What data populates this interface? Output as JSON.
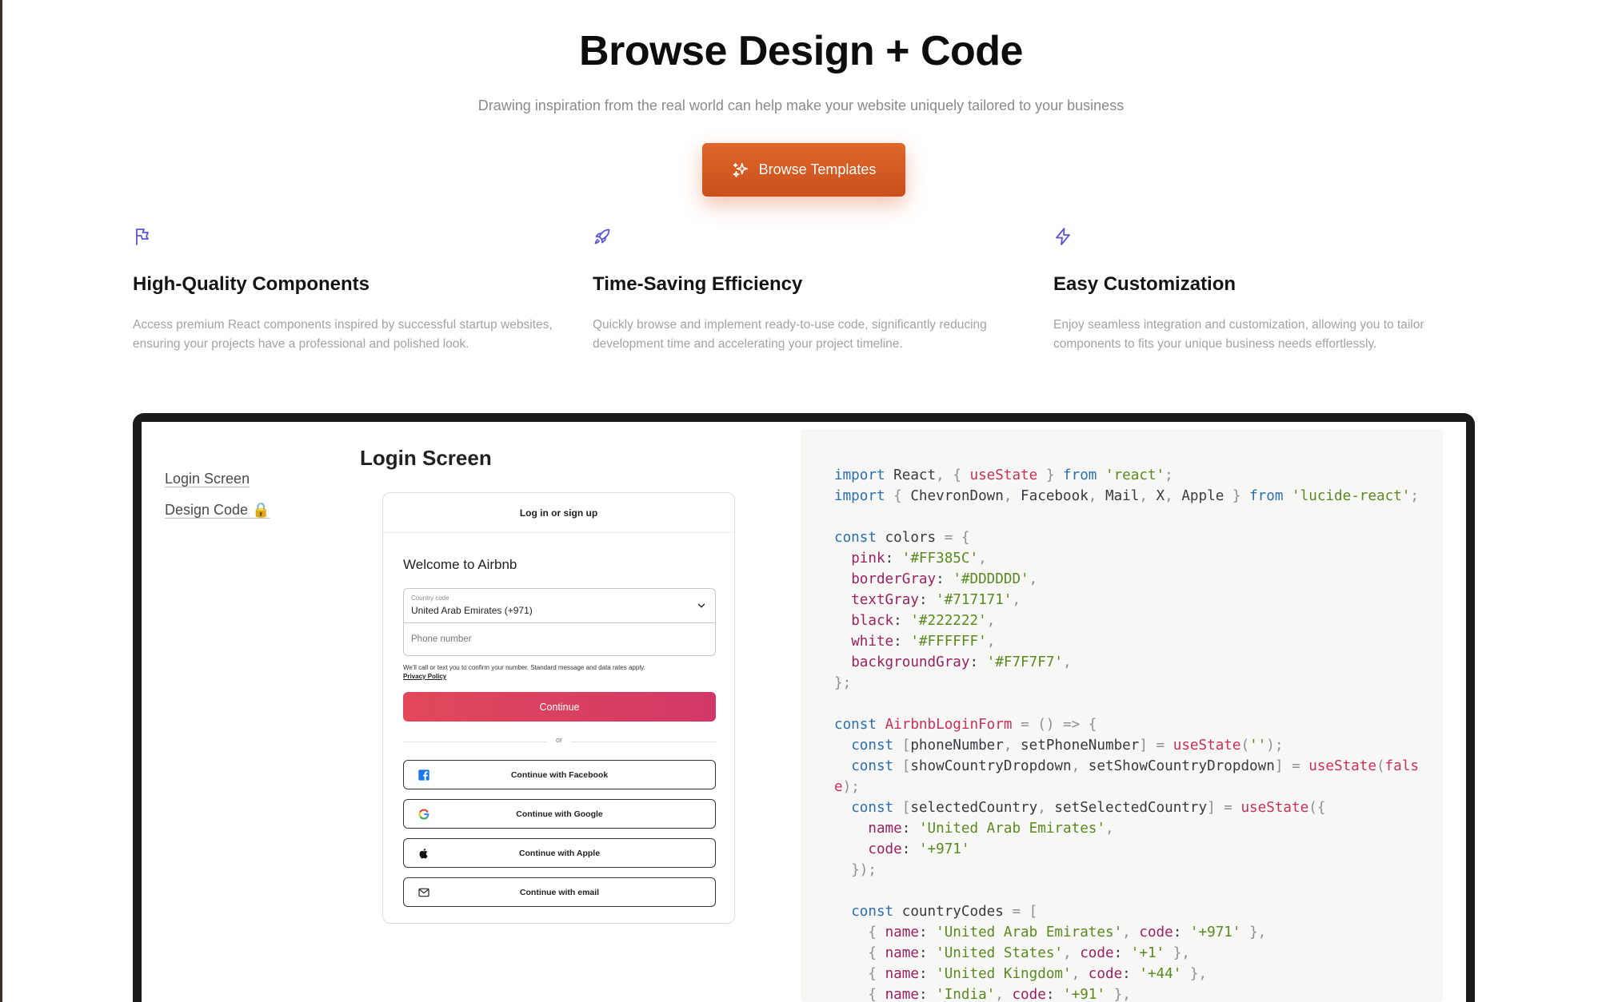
{
  "hero": {
    "title": "Browse Design + Code",
    "subtitle": "Drawing inspiration from the real world can help make your website uniquely tailored to your business",
    "cta_label": "Browse Templates",
    "cta_icon": "sparkles-icon",
    "cta_color": "#D95E28"
  },
  "features": [
    {
      "icon": "flag-icon",
      "title": "High-Quality Components",
      "description": "Access premium React components inspired by successful startup websites, ensuring your projects have a professional and polished look."
    },
    {
      "icon": "rocket-icon",
      "title": "Time-Saving Efficiency",
      "description": "Quickly browse and implement ready-to-use code, significantly reducing development time and accelerating your project timeline."
    },
    {
      "icon": "zap-icon",
      "title": "Easy Customization",
      "description": "Enjoy seamless integration and customization, allowing you to tailor components to fits your unique business needs effortlessly."
    }
  ],
  "showcase": {
    "sidebar": [
      {
        "label": "Login Screen"
      },
      {
        "label": "Design Code 🔒"
      }
    ],
    "preview_title": "Login Screen",
    "login_card": {
      "header": "Log in or sign up",
      "welcome": "Welcome to Airbnb",
      "country_label": "Country code",
      "country_value": "United Arab Emirates (+971)",
      "phone_placeholder": "Phone number",
      "notice": "We'll call or text you to confirm your number. Standard message and data rates apply.",
      "privacy_link": "Privacy Policy",
      "continue_label": "Continue",
      "continue_color": "#E2485A",
      "divider_label": "or",
      "social_buttons": [
        {
          "label": "Continue with Facebook",
          "icon": "facebook-icon"
        },
        {
          "label": "Continue with Google",
          "icon": "google-icon"
        },
        {
          "label": "Continue with Apple",
          "icon": "apple-icon"
        },
        {
          "label": "Continue with email",
          "icon": "mail-icon"
        }
      ]
    },
    "code_lines": [
      "import React, { useState } from 'react';",
      "import { ChevronDown, Facebook, Mail, X, Apple } from 'lucide-react';",
      "",
      "const colors = {",
      "  pink: '#FF385C',",
      "  borderGray: '#DDDDDD',",
      "  textGray: '#717171',",
      "  black: '#222222',",
      "  white: '#FFFFFF',",
      "  backgroundGray: '#F7F7F7',",
      "};",
      "",
      "const AirbnbLoginForm = () => {",
      "  const [phoneNumber, setPhoneNumber] = useState('');",
      "  const [showCountryDropdown, setShowCountryDropdown] = useState(fals",
      "e);",
      "  const [selectedCountry, setSelectedCountry] = useState({",
      "    name: 'United Arab Emirates',",
      "    code: '+971'",
      "  });",
      "",
      "  const countryCodes = [",
      "    { name: 'United Arab Emirates', code: '+971' },",
      "    { name: 'United States', code: '+1' },",
      "    { name: 'United Kingdom', code: '+44' },",
      "    { name: 'India', code: '+91' },"
    ]
  }
}
